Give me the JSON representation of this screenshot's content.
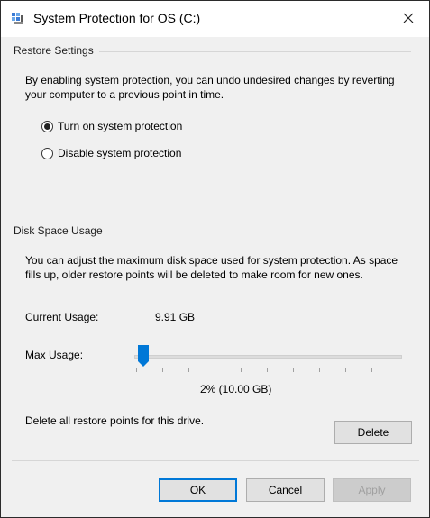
{
  "window": {
    "title": "System Protection for OS (C:)"
  },
  "restore_settings": {
    "group_label": "Restore Settings",
    "description": "By enabling system protection, you can undo undesired changes by reverting your computer to a previous point in time.",
    "options": [
      {
        "label": "Turn on system protection",
        "checked": true
      },
      {
        "label": "Disable system protection",
        "checked": false
      }
    ]
  },
  "disk_space": {
    "group_label": "Disk Space Usage",
    "description": "You can adjust the maximum disk space used for system protection. As space fills up, older restore points will be deleted to make room for new ones.",
    "current_usage_label": "Current Usage:",
    "current_usage_value": "9.91 GB",
    "max_usage_label": "Max Usage:",
    "max_usage_percent": 2,
    "max_usage_readout": "2% (10.00 GB)",
    "delete_text": "Delete all restore points for this drive.",
    "delete_button": "Delete"
  },
  "footer": {
    "ok": "OK",
    "cancel": "Cancel",
    "apply": "Apply"
  },
  "colors": {
    "accent": "#0078d7",
    "window_bg": "#f0f0f0"
  },
  "icons": {
    "title": "system-protection-icon",
    "close": "close-icon"
  }
}
